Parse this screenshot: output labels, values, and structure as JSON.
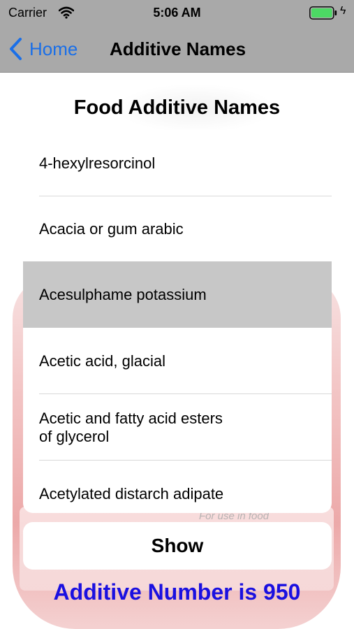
{
  "status_bar": {
    "carrier": "Carrier",
    "time": "5:06 AM",
    "battery_color": "#4cd964"
  },
  "nav": {
    "back_label": "Home",
    "title": "Additive Names"
  },
  "page_title": "Food Additive Names",
  "picker": {
    "items": [
      "4-hexylresorcinol",
      "Acacia or gum arabic",
      "Acesulphame potassium",
      "Acetic acid, glacial",
      "Acetic and fatty acid esters\nof glycerol",
      "Acetylated distarch adipate"
    ],
    "selected_index": 2
  },
  "show_button": "Show",
  "result": "Additive Number is 950",
  "background_label_text": "For use in food",
  "colors": {
    "bar_gray": "#a9a9a9",
    "accent_blue": "#1a6fe8",
    "result_blue": "#1a10e0",
    "selected_row": "#c7c7c7"
  }
}
